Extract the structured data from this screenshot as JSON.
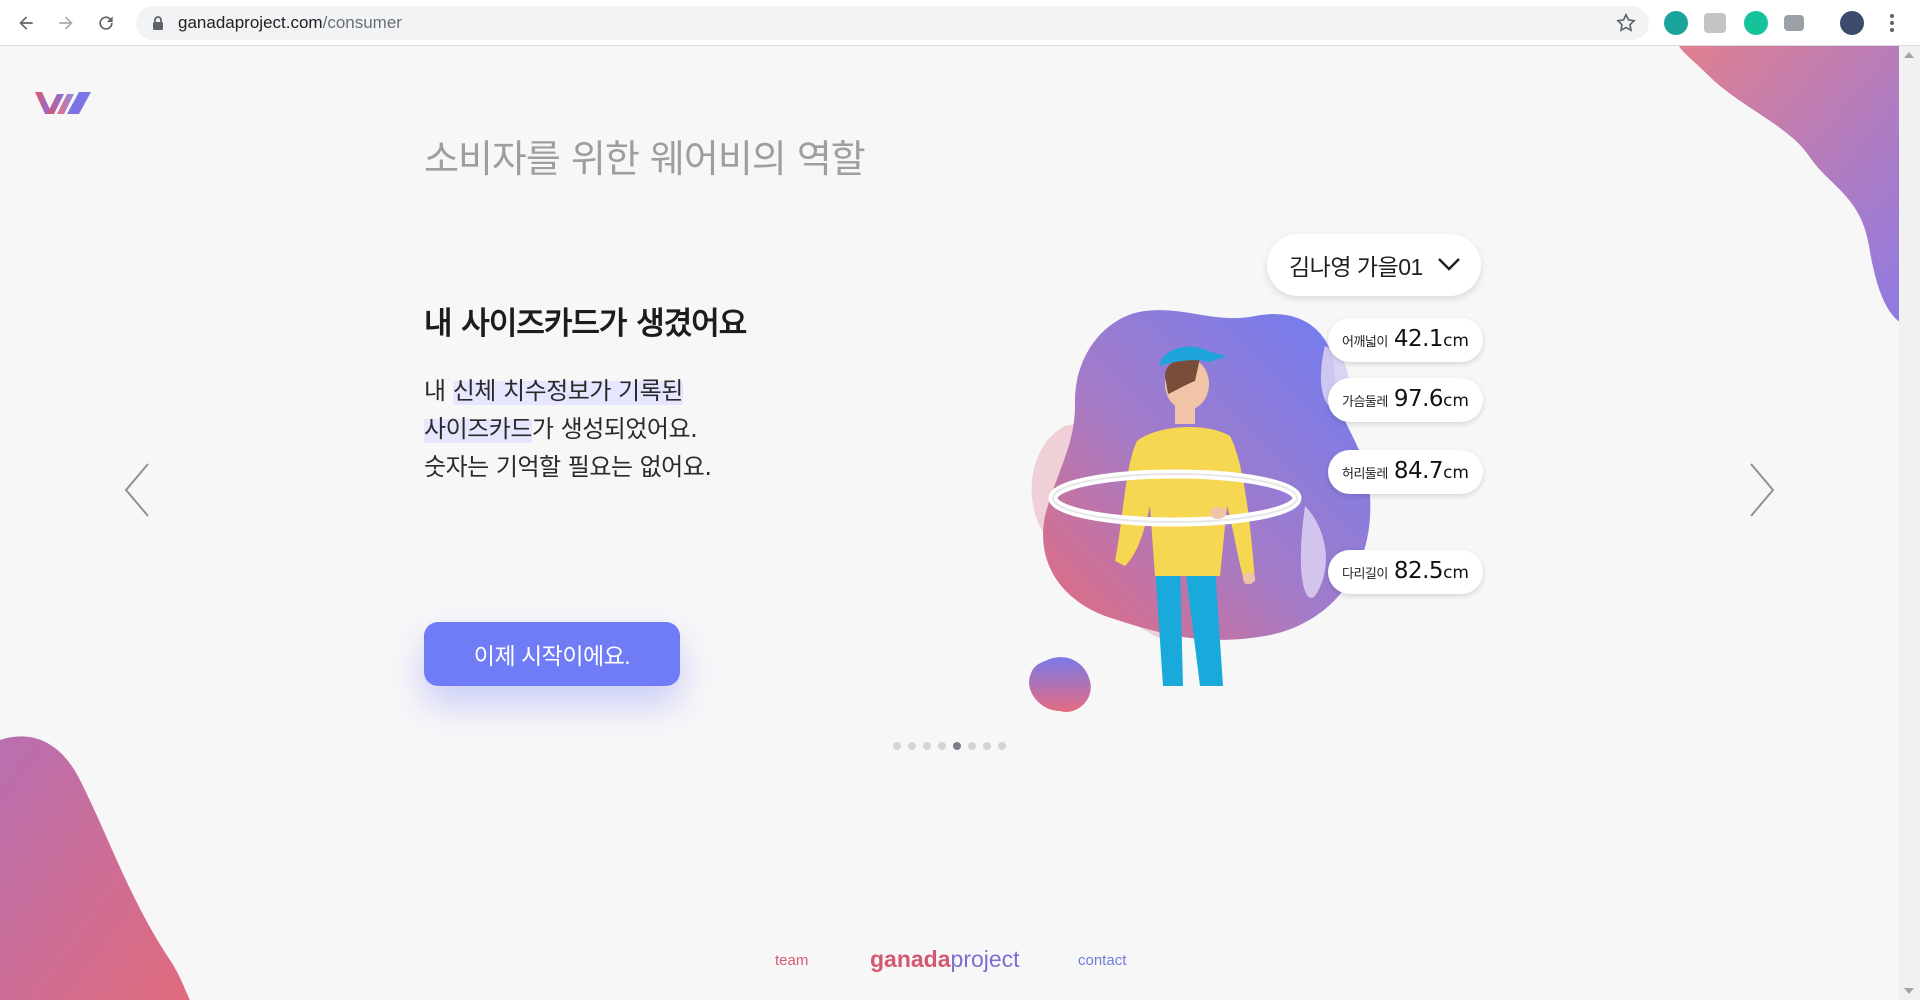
{
  "browser": {
    "url_host": "ganadaproject.com",
    "url_path": "/consumer"
  },
  "page": {
    "section_title": "소비자를 위한 웨어비의 역할",
    "heading": "내 사이즈카드가 생겼어요",
    "desc": {
      "line1_plain": "내 ",
      "line1_highlight": "신체 치수정보가 기록된",
      "line2_highlight": "사이즈카드",
      "line2_plain": "가 생성되었어요.",
      "line3": "숫자는 기억할 필요는 없어요."
    },
    "cta_label": "이제 시작이에요.",
    "carousel": {
      "total": 8,
      "active_index": 4
    }
  },
  "sizecard": {
    "profile": "김나영 가을01",
    "measurements": [
      {
        "label": "어깨넓이",
        "value": "42.1",
        "unit": "cm"
      },
      {
        "label": "가슴둘레",
        "value": "97.6",
        "unit": "cm"
      },
      {
        "label": "허리둘레",
        "value": "84.7",
        "unit": "cm"
      },
      {
        "label": "다리길이",
        "value": "82.5",
        "unit": "cm"
      }
    ]
  },
  "footer": {
    "team": "team",
    "brand_a": "ganada",
    "brand_b": "project",
    "contact": "contact"
  },
  "colors": {
    "accent": "#6f7cf6",
    "brand_pink": "#d55871",
    "brand_purple": "#7d6fd1"
  }
}
